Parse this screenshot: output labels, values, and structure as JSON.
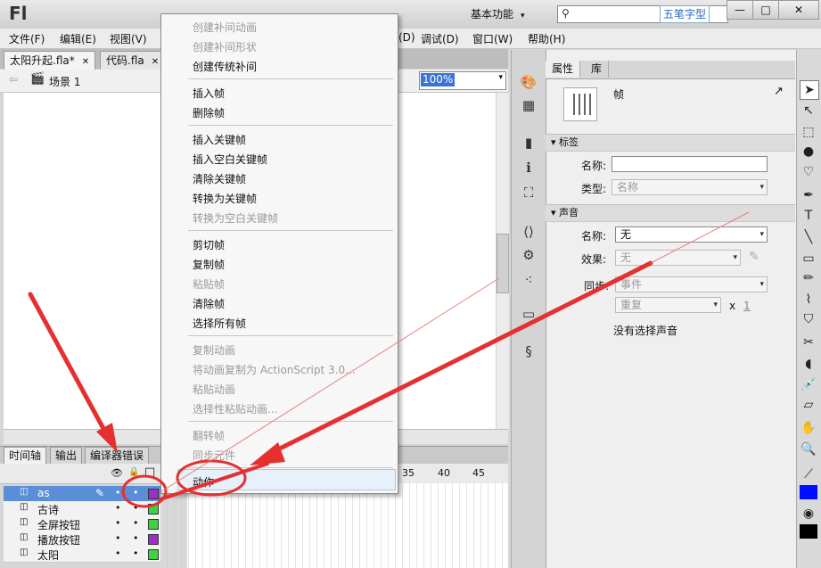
{
  "titlebar": {
    "logo": "Fl",
    "workspace": "基本功能",
    "workspace_arrow": "▾",
    "search_icon": "⚲",
    "search_placeholder": "",
    "watermark": "五笔字型",
    "win_min": "—",
    "win_max": "□",
    "win_close": "✕"
  },
  "menubar": {
    "items": [
      "文件(F)",
      "编辑(E)",
      "视图(V)",
      "(D)",
      "调试(D)",
      "窗口(W)",
      "帮助(H)"
    ]
  },
  "doctabs": {
    "tabs": [
      "太阳升起.fla*",
      "代码.fla"
    ],
    "close": "✕"
  },
  "scenebar": {
    "back": "⇦",
    "scene_icon": "🎬",
    "scene": "场景 1",
    "zoom": "100%",
    "zoom_arrow": "▾"
  },
  "timeline": {
    "tabs": [
      "时间轴",
      "输出",
      "编译器错误"
    ],
    "eye": "👁",
    "lock": "🔒",
    "outline": "□",
    "ruler": [
      "35",
      "40",
      "45"
    ],
    "layers": [
      {
        "name": "as",
        "color": "#9a30c8",
        "selected": true
      },
      {
        "name": "古诗",
        "color": "#3fd23f",
        "selected": false
      },
      {
        "name": "全屏按钮",
        "color": "#3fd23f",
        "selected": false
      },
      {
        "name": "播放按钮",
        "color": "#9a30c8",
        "selected": false
      },
      {
        "name": "太阳",
        "color": "#3fd23f",
        "selected": false
      }
    ],
    "layer_icon": "◫",
    "dot": "•",
    "pencil": "✎"
  },
  "context_menu": {
    "items": [
      {
        "label": "创建补间动画",
        "disabled": true
      },
      {
        "label": "创建补间形状",
        "disabled": true
      },
      {
        "label": "创建传统补间",
        "disabled": false
      },
      {
        "label": "插入帧",
        "disabled": false
      },
      {
        "label": "删除帧",
        "disabled": false
      },
      {
        "label": "插入关键帧",
        "disabled": false
      },
      {
        "label": "插入空白关键帧",
        "disabled": false
      },
      {
        "label": "清除关键帧",
        "disabled": false
      },
      {
        "label": "转换为关键帧",
        "disabled": false
      },
      {
        "label": "转换为空白关键帧",
        "disabled": true
      },
      {
        "label": "剪切帧",
        "disabled": false
      },
      {
        "label": "复制帧",
        "disabled": false
      },
      {
        "label": "粘贴帧",
        "disabled": true
      },
      {
        "label": "清除帧",
        "disabled": false
      },
      {
        "label": "选择所有帧",
        "disabled": false
      },
      {
        "label": "复制动画",
        "disabled": true
      },
      {
        "label": "将动画复制为 ActionScript 3.0...",
        "disabled": true
      },
      {
        "label": "粘贴动画",
        "disabled": true
      },
      {
        "label": "选择性粘贴动画...",
        "disabled": true
      },
      {
        "label": "翻转帧",
        "disabled": true
      },
      {
        "label": "同步元件",
        "disabled": true
      },
      {
        "label": "动作",
        "disabled": false
      }
    ]
  },
  "properties": {
    "tabs": [
      "属性",
      "库"
    ],
    "type": "帧",
    "link_icon": "↗",
    "label_section": "标签",
    "name_label": "名称:",
    "name_value": "",
    "type_label": "类型:",
    "type_value": "名称",
    "sound_section": "声音",
    "sound_name_label": "名称:",
    "sound_name_value": "无",
    "effect_label": "效果:",
    "effect_value": "无",
    "sync_label": "同步:",
    "sync_value": "事件",
    "repeat_value": "重复",
    "repeat_x": "x",
    "repeat_count": "1",
    "no_sound": "没有选择声音",
    "arrow": "▾",
    "edit_icon": "✎"
  },
  "toolstrip": {
    "icons": [
      "🎨",
      "▦",
      "▮",
      "ℹ",
      "⛶",
      "⟨⟩",
      "⚙",
      "⁖",
      "▭",
      "§"
    ]
  },
  "toolsbar": {
    "icons": [
      "➤",
      "↖",
      "⬚",
      "●",
      "♡",
      "✒",
      "T",
      "╲",
      "▭",
      "✏",
      "⌇",
      "⛉",
      "✂",
      "◖",
      "💉",
      "▱",
      "✋",
      "🔍",
      "⟋",
      "■",
      "◉",
      "■"
    ]
  },
  "colors": {
    "arrow": "#e53030",
    "circle": "#e53030",
    "stroke_swatch": "#0010ff",
    "fill_swatch": "#000000"
  }
}
